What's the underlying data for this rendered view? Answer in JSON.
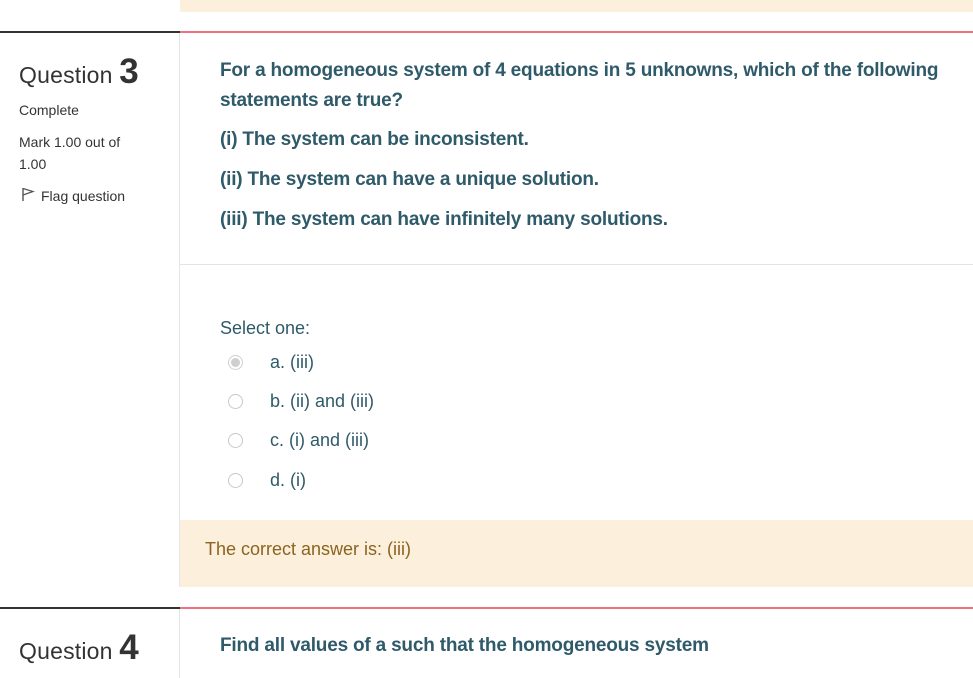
{
  "question3": {
    "label": "Question",
    "number": "3",
    "state": "Complete",
    "mark": "Mark 1.00 out of",
    "mark_total": "1.00",
    "flag_label": "Flag question",
    "text_lines": [
      "For a homogeneous system of 4 equations in 5 unknowns, which of the following",
      "statements are true?",
      "(i) The system can be inconsistent.",
      "(ii) The system can have a unique solution.",
      "(iii) The system can have infinitely many solutions."
    ],
    "prompt": "Select one:",
    "options": [
      {
        "label": "a. (iii)",
        "selected": true
      },
      {
        "label": "b. (ii) and (iii)",
        "selected": false
      },
      {
        "label": "c. (i) and (iii)",
        "selected": false
      },
      {
        "label": "d. (i)",
        "selected": false
      }
    ],
    "feedback": "The correct answer is: (iii)"
  },
  "question4": {
    "label": "Question",
    "number": "4",
    "text": "Find all values of a such that the homogeneous system"
  },
  "colors": {
    "accent_rule": "#f0707b",
    "question_text": "#2f5a6a",
    "feedback_bg": "#fcefdc",
    "feedback_text": "#8a6420"
  },
  "icons": {
    "flag": "flag-icon",
    "radio": "radio-button"
  }
}
